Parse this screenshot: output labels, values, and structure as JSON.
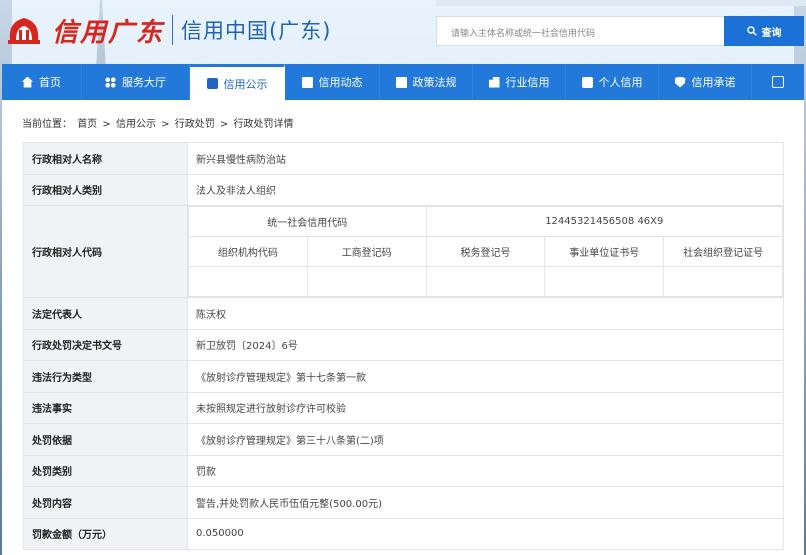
{
  "header": {
    "logo_brush": "信用广东",
    "logo_title": "信用中国(广东)",
    "search_placeholder": "请输入主体名称或统一社会信用代码",
    "search_button": "查询"
  },
  "nav": {
    "items": [
      {
        "label": "首页",
        "icon": "home-icon"
      },
      {
        "label": "服务大厅",
        "icon": "grid-icon"
      },
      {
        "label": "信用公示",
        "icon": "monitor-icon"
      },
      {
        "label": "信用动态",
        "icon": "doc-icon"
      },
      {
        "label": "政策法规",
        "icon": "book-icon"
      },
      {
        "label": "行业信用",
        "icon": "building-icon"
      },
      {
        "label": "个人信用",
        "icon": "person-icon"
      },
      {
        "label": "信用承诺",
        "icon": "shield-icon"
      }
    ],
    "active_index": 2
  },
  "breadcrumb": {
    "prefix": "当前位置：",
    "items": [
      "首页",
      "信用公示",
      "行政处罚",
      "行政处罚详情"
    ],
    "separator": ">"
  },
  "detail": {
    "name_label": "行政相对人名称",
    "name_value": "新兴县慢性病防治站",
    "type_label": "行政相对人类别",
    "type_value": "法人及非法人组织",
    "code_label": "行政相对人代码",
    "uscc_label": "统一社会信用代码",
    "uscc_value": "12445321456508 46X9",
    "code_headers": [
      "组织机构代码",
      "工商登记码",
      "税务登记号",
      "事业单位证书号",
      "社会组织登记证号"
    ],
    "code_values": [
      "",
      "",
      "",
      "",
      ""
    ],
    "rows": [
      {
        "label": "法定代表人",
        "value": "陈沃权"
      },
      {
        "label": "行政处罚决定书文号",
        "value": "新卫放罚〔2024〕6号"
      },
      {
        "label": "违法行为类型",
        "value": "《放射诊疗管理规定》第十七条第一款"
      },
      {
        "label": "违法事实",
        "value": "未按照规定进行放射诊疗许可校验"
      },
      {
        "label": "处罚依据",
        "value": "《放射诊疗管理规定》第三十八条第(二)项"
      },
      {
        "label": "处罚类别",
        "value": "罚款"
      },
      {
        "label": "处罚内容",
        "value": "警告,并处罚款人民币伍佰元整(500.00元)"
      },
      {
        "label": "罚款金额（万元）",
        "value": "0.050000"
      }
    ]
  }
}
